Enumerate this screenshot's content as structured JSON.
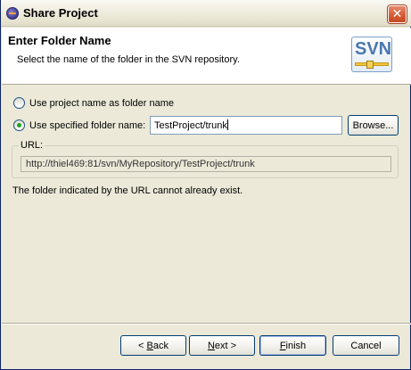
{
  "window": {
    "title": "Share Project",
    "close_symbol": "✕"
  },
  "banner": {
    "title": "Enter Folder Name",
    "description": "Select the name of the folder in the SVN repository.",
    "logo_text": "SVN"
  },
  "options": {
    "project_name_label": "Use project name as folder name",
    "specified_name_label": "Use specified folder name:",
    "selected": "specified"
  },
  "folder_input": {
    "value": "TestProject/trunk"
  },
  "browse_button": {
    "label": "Browse..."
  },
  "url": {
    "legend": "URL:",
    "value": "http://thiel469:81/svn/MyRepository/TestProject/trunk"
  },
  "info_text": "The folder indicated by the URL cannot already exist.",
  "footer": {
    "back_prefix": "< ",
    "back_mnemonic": "B",
    "back_rest": "ack",
    "next_mnemonic": "N",
    "next_rest": "ext >",
    "finish_mnemonic": "F",
    "finish_rest": "inish",
    "cancel_label": "Cancel"
  },
  "colors": {
    "dialog_bg": "#ece9d8",
    "banner_bg": "#ffffff",
    "svn_blue": "#4a78ad",
    "close_red": "#d35a33"
  }
}
